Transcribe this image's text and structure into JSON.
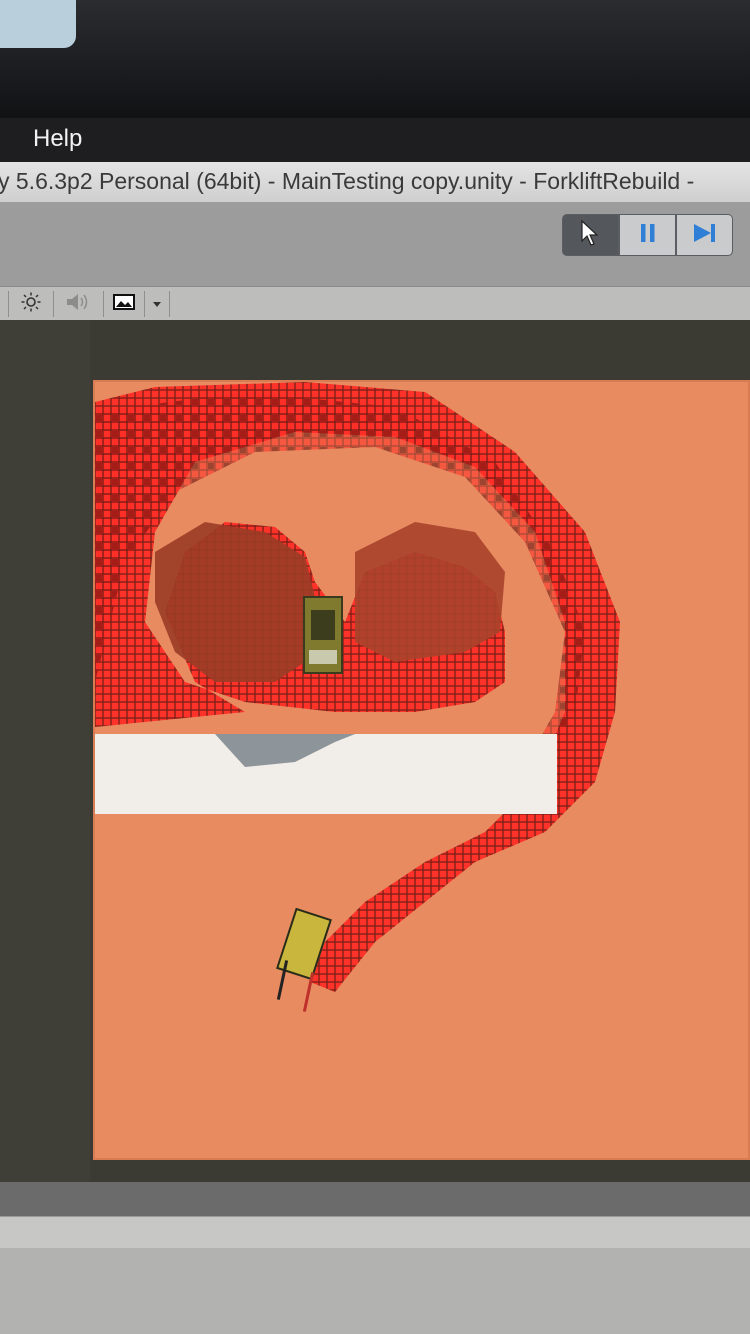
{
  "menu": {
    "help_label": "Help"
  },
  "window": {
    "title": "y 5.6.3p2 Personal (64bit) - MainTesting copy.unity - ForkliftRebuild -"
  },
  "play_controls": [
    {
      "name": "cursor-tool",
      "icon": "cursor-icon"
    },
    {
      "name": "pause",
      "icon": "pause-icon"
    },
    {
      "name": "step",
      "icon": "step-icon"
    }
  ],
  "scene_toolbar": [
    {
      "icon": "sun-icon"
    },
    {
      "icon": "speaker-icon"
    },
    {
      "icon": "image-icon"
    },
    {
      "icon": "dropdown-arrow-icon"
    }
  ],
  "colors": {
    "ground": "#e98b60",
    "grid_cell": "#ff2a2a",
    "grid_dark": "#6a0d0d",
    "wall": "#f1ede8"
  }
}
